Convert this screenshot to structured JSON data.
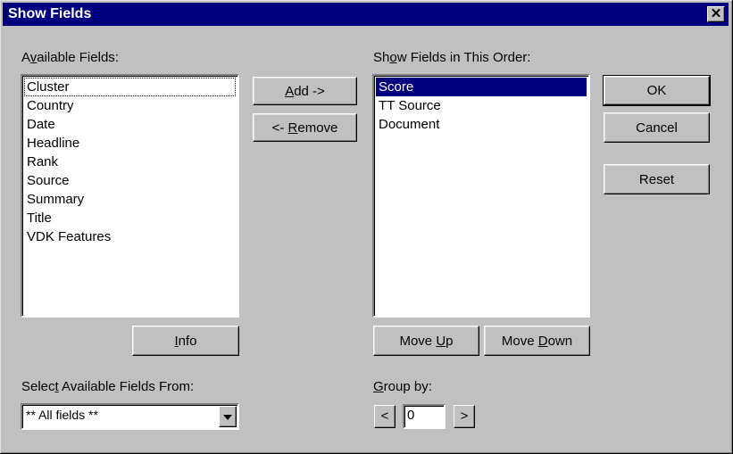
{
  "window": {
    "title": "Show Fields",
    "close_glyph": "✕"
  },
  "available": {
    "label_prefix": "A",
    "label_ul": "v",
    "label_rest": "ailable Fields:",
    "items": [
      "Cluster",
      "Country",
      "Date",
      "Headline",
      "Rank",
      "Source",
      "Summary",
      "Title",
      "VDK Features"
    ],
    "focused_item": "Cluster"
  },
  "buttons": {
    "add_ul": "A",
    "add_rest": "dd ->",
    "remove_prefix": "<- ",
    "remove_ul": "R",
    "remove_rest": "emove",
    "info_ul": "I",
    "info_rest": "nfo",
    "ok": "OK",
    "cancel": "Cancel",
    "reset": "Reset",
    "move_up_prefix": "Move ",
    "move_up_ul": "U",
    "move_up_rest": "p",
    "move_down_prefix": "Move ",
    "move_down_ul": "D",
    "move_down_rest": "own"
  },
  "shown": {
    "label_prefix": "Sh",
    "label_ul": "o",
    "label_rest": "w Fields in This Order:",
    "items": [
      "Score",
      "TT Source",
      "Document"
    ],
    "selected_item": "Score"
  },
  "select_from": {
    "label_prefix": "Selec",
    "label_ul": "t",
    "label_rest": " Available Fields From:",
    "value": "** All fields **",
    "arrow_icon": "chevron-down-icon"
  },
  "group_by": {
    "label_ul": "G",
    "label_rest": "roup by:",
    "value": "0",
    "prev_glyph": "<",
    "next_glyph": ">"
  },
  "colors": {
    "title_bar": "#000080",
    "face": "#c0c0c0",
    "selection": "#000080"
  }
}
